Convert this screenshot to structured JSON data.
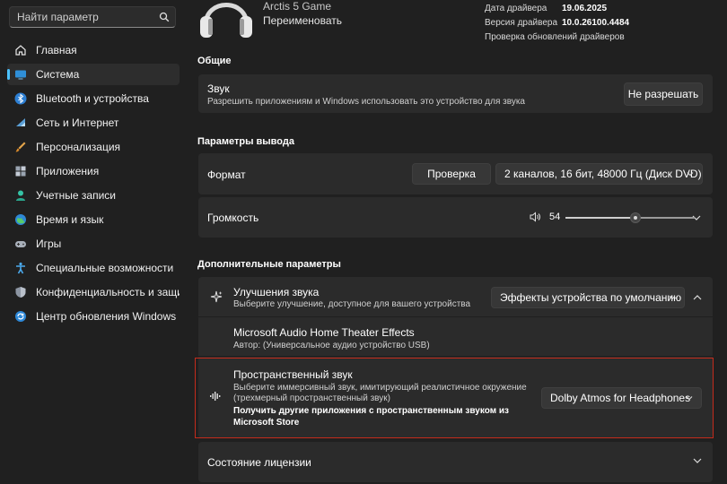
{
  "sidebar": {
    "search_placeholder": "Найти параметр",
    "items": [
      {
        "label": "Главная",
        "icon": "home-icon",
        "active": false
      },
      {
        "label": "Система",
        "icon": "system-icon",
        "active": true
      },
      {
        "label": "Bluetooth и устройства",
        "icon": "bluetooth-icon",
        "active": false
      },
      {
        "label": "Сеть и Интернет",
        "icon": "network-icon",
        "active": false
      },
      {
        "label": "Персонализация",
        "icon": "brush-icon",
        "active": false
      },
      {
        "label": "Приложения",
        "icon": "apps-icon",
        "active": false
      },
      {
        "label": "Учетные записи",
        "icon": "accounts-icon",
        "active": false
      },
      {
        "label": "Время и язык",
        "icon": "globe-icon",
        "active": false
      },
      {
        "label": "Игры",
        "icon": "gamepad-icon",
        "active": false
      },
      {
        "label": "Специальные возможности",
        "icon": "accessibility-icon",
        "active": false
      },
      {
        "label": "Конфиденциальность и защита",
        "icon": "shield-icon",
        "active": false
      },
      {
        "label": "Центр обновления Windows",
        "icon": "update-icon",
        "active": false
      }
    ]
  },
  "device": {
    "name": "Arctis 5 Game",
    "rename": "Переименовать",
    "driver_date_label": "Дата драйвера",
    "driver_date": "19.06.2025",
    "driver_version_label": "Версия драйвера",
    "driver_version": "10.0.26100.4484",
    "check_updates": "Проверка обновлений драйверов"
  },
  "general": {
    "title": "Общие",
    "audio_title": "Звук",
    "audio_desc": "Разрешить приложениям и Windows использовать это устройство для звука",
    "audio_button": "Не разрешать"
  },
  "output": {
    "title": "Параметры вывода",
    "format_label": "Формат",
    "test_button": "Проверка",
    "format_value": "2 каналов, 16 бит, 48000 Гц (Диск DVD)",
    "volume_label": "Громкость",
    "volume_value": "54",
    "volume_fraction": 0.54
  },
  "advanced": {
    "title": "Дополнительные параметры",
    "enh_title": "Улучшения звука",
    "enh_desc": "Выберите улучшение, доступное для вашего устройства",
    "enh_value": "Эффекты устройства по умолчанию",
    "ms_title": "Microsoft Audio Home Theater Effects",
    "ms_author": "Автор: (Универсальное аудио устройство USB)",
    "spatial_title": "Пространственный звук",
    "spatial_desc1": "Выберите иммерсивный звук, имитирующий реалистичное окружение",
    "spatial_desc2": "(трехмерный пространственный звук)",
    "spatial_link1": "Получить другие приложения с пространственным звуком из",
    "spatial_link2": "Microsoft Store",
    "spatial_value": "Dolby Atmos for Headphones",
    "license_title": "Состояние лицензии"
  },
  "colors": {
    "accent": "#4cc2ff",
    "highlight_border": "#c42b1c"
  }
}
